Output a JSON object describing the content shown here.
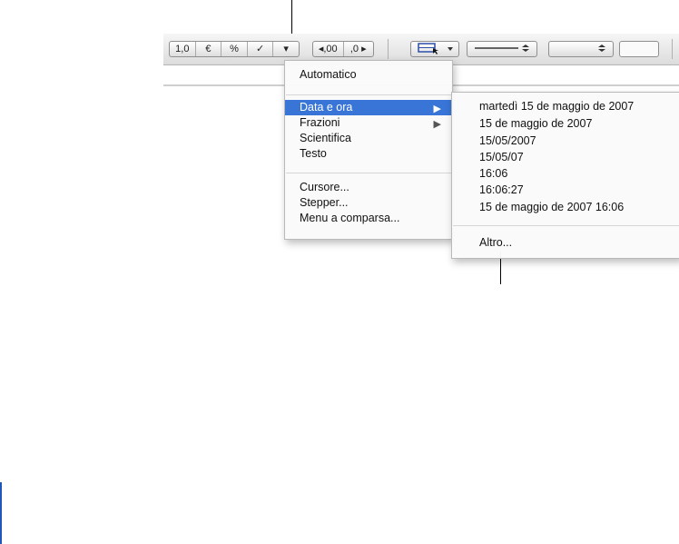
{
  "toolbar": {
    "format_buttons": [
      "1,0",
      "€",
      "%",
      "✓",
      "▾"
    ],
    "decimal_buttons": [
      "◂,00",
      ",0 ▸"
    ]
  },
  "format_menu": {
    "items": [
      {
        "label": "Automatico"
      },
      {
        "label": "Data e ora",
        "selected": true,
        "submenu": true
      },
      {
        "label": "Frazioni",
        "submenu": true
      },
      {
        "label": "Scientifica"
      },
      {
        "label": "Testo"
      },
      {
        "label": "Cursore..."
      },
      {
        "label": "Stepper..."
      },
      {
        "label": "Menu a comparsa..."
      }
    ]
  },
  "date_submenu": {
    "items": [
      "martedì 15 de maggio de 2007",
      "15 de maggio de 2007",
      "15/05/2007",
      "15/05/07",
      "16:06",
      "16:06:27",
      "15 de maggio de 2007 16:06"
    ],
    "other_label": "Altro..."
  },
  "colors": {
    "selection": "#3875d7",
    "accent_bar": "#1f55b8"
  },
  "icons": {
    "submenu_arrow": "▶"
  }
}
